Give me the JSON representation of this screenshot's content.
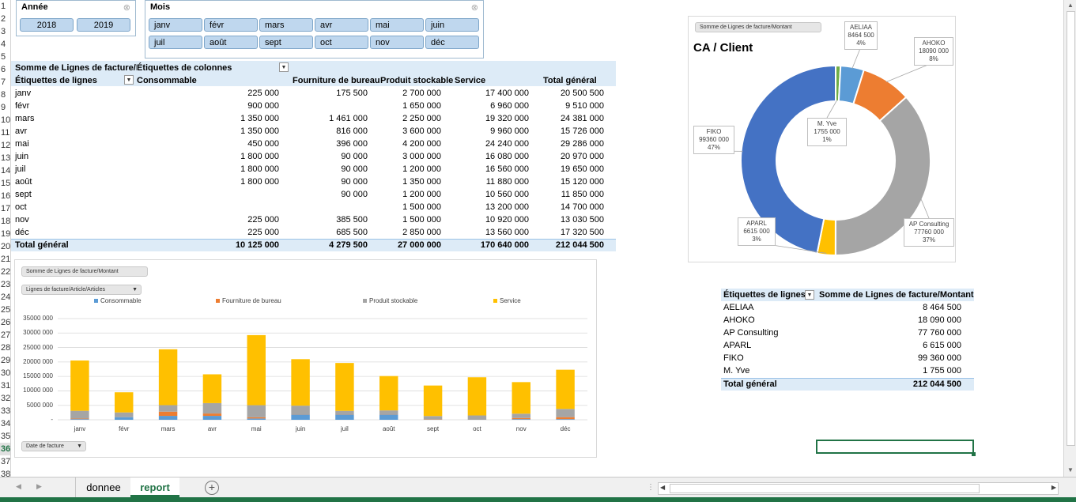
{
  "slicers": {
    "year": {
      "title": "Année",
      "items": [
        "2018",
        "2019"
      ]
    },
    "month": {
      "title": "Mois",
      "items": [
        "janv",
        "févr",
        "mars",
        "avr",
        "mai",
        "juin",
        "juil",
        "août",
        "sept",
        "oct",
        "nov",
        "déc"
      ]
    }
  },
  "pivot": {
    "header_value": "Somme de Lignes de facture/Montant",
    "header_columns": "Étiquettes de colonnes",
    "row_label": "Étiquettes de lignes",
    "columns": [
      "Consommable",
      "Fourniture de bureau",
      "Produit stockable",
      "Service",
      "Total général"
    ],
    "rows": [
      {
        "label": "janv",
        "values": [
          "225 000",
          "175 500",
          "2 700 000",
          "17 400 000",
          "20 500 500"
        ]
      },
      {
        "label": "févr",
        "values": [
          "900 000",
          "",
          "1 650 000",
          "6 960 000",
          "9 510 000"
        ]
      },
      {
        "label": "mars",
        "values": [
          "1 350 000",
          "1 461 000",
          "2 250 000",
          "19 320 000",
          "24 381 000"
        ]
      },
      {
        "label": "avr",
        "values": [
          "1 350 000",
          "816 000",
          "3 600 000",
          "9 960 000",
          "15 726 000"
        ]
      },
      {
        "label": "mai",
        "values": [
          "450 000",
          "396 000",
          "4 200 000",
          "24 240 000",
          "29 286 000"
        ]
      },
      {
        "label": "juin",
        "values": [
          "1 800 000",
          "90 000",
          "3 000 000",
          "16 080 000",
          "20 970 000"
        ]
      },
      {
        "label": "juil",
        "values": [
          "1 800 000",
          "90 000",
          "1 200 000",
          "16 560 000",
          "19 650 000"
        ]
      },
      {
        "label": "août",
        "values": [
          "1 800 000",
          "90 000",
          "1 350 000",
          "11 880 000",
          "15 120 000"
        ]
      },
      {
        "label": "sept",
        "values": [
          "",
          "90 000",
          "1 200 000",
          "10 560 000",
          "11 850 000"
        ]
      },
      {
        "label": "oct",
        "values": [
          "",
          "",
          "1 500 000",
          "13 200 000",
          "14 700 000"
        ]
      },
      {
        "label": "nov",
        "values": [
          "225 000",
          "385 500",
          "1 500 000",
          "10 920 000",
          "13 030 500"
        ]
      },
      {
        "label": "déc",
        "values": [
          "225 000",
          "685 500",
          "2 850 000",
          "13 560 000",
          "17 320 500"
        ]
      }
    ],
    "total_label": "Total général",
    "total_values": [
      "10 125 000",
      "4 279 500",
      "27 000 000",
      "170 640 000",
      "212 044 500"
    ]
  },
  "client_table": {
    "row_label": "Étiquettes de lignes",
    "value_label": "Somme de Lignes de facture/Montant",
    "rows": [
      {
        "label": "AELIAA",
        "value": "8 464 500"
      },
      {
        "label": "AHOKO",
        "value": "18 090 000"
      },
      {
        "label": "AP Consulting",
        "value": "77 760 000"
      },
      {
        "label": "APARL",
        "value": "6 615 000"
      },
      {
        "label": "FIKO",
        "value": "99 360 000"
      },
      {
        "label": "M. Yve",
        "value": "1 755 000"
      }
    ],
    "total_label": "Total général",
    "total_value": "212 044 500"
  },
  "donut_chart": {
    "field_button": "Somme de Lignes de facture/Montant",
    "title": "CA / Client",
    "chart_data": {
      "type": "pie",
      "title": "CA / Client",
      "labels": [
        "M. Yve",
        "AELIAA",
        "AHOKO",
        "AP Consulting",
        "APARL",
        "FIKO"
      ],
      "values": [
        1755000,
        8464500,
        18090000,
        77760000,
        6615000,
        99360000
      ],
      "colors": [
        "#70ad47",
        "#5b9bd5",
        "#ed7d31",
        "#a5a5a5",
        "#ffc000",
        "#4472c4"
      ],
      "callouts": [
        {
          "name": "AELIAA",
          "value": "8464 500",
          "pct": "4%"
        },
        {
          "name": "AHOKO",
          "value": "18090 000",
          "pct": "8%"
        },
        {
          "name": "M. Yve",
          "value": "1755 000",
          "pct": "1%"
        },
        {
          "name": "FIKO",
          "value": "99360 000",
          "pct": "47%"
        },
        {
          "name": "APARL",
          "value": "6615 000",
          "pct": "3%"
        },
        {
          "name": "AP Consulting",
          "value": "77760 000",
          "pct": "37%"
        }
      ]
    }
  },
  "bar_chart": {
    "field_button_value": "Somme de Lignes de facture/Montant",
    "field_button_axis": "Lignes de facture/Article/Articles",
    "field_button_date": "Date de facture",
    "chart_data": {
      "type": "bar",
      "stacked": true,
      "categories": [
        "janv",
        "févr",
        "mars",
        "avr",
        "mai",
        "juin",
        "juil",
        "août",
        "sept",
        "oct",
        "nov",
        "déc"
      ],
      "series": [
        {
          "name": "Consommable",
          "color": "#5b9bd5",
          "values": [
            225000,
            900000,
            1350000,
            1350000,
            450000,
            1800000,
            1800000,
            1800000,
            0,
            0,
            225000,
            225000
          ]
        },
        {
          "name": "Fourniture de bureau",
          "color": "#ed7d31",
          "values": [
            175500,
            0,
            1461000,
            816000,
            396000,
            90000,
            90000,
            90000,
            90000,
            0,
            385500,
            685500
          ]
        },
        {
          "name": "Produit stockable",
          "color": "#a5a5a5",
          "values": [
            2700000,
            1650000,
            2250000,
            3600000,
            4200000,
            3000000,
            1200000,
            1350000,
            1200000,
            1500000,
            1500000,
            2850000
          ]
        },
        {
          "name": "Service",
          "color": "#ffc000",
          "values": [
            17400000,
            6960000,
            19320000,
            9960000,
            24240000,
            16080000,
            16560000,
            11880000,
            10560000,
            13200000,
            10920000,
            13560000
          ]
        }
      ],
      "ylim": [
        0,
        35000000
      ],
      "yticks": [
        "35000 000",
        "30000 000",
        "25000 000",
        "20000 000",
        "15000 000",
        "10000 000",
        "5000 000",
        "-"
      ],
      "legend_position": "top",
      "grid": true
    }
  },
  "sheet_tabs": [
    "donnee",
    "report"
  ],
  "active_tab": "report",
  "add_sheet_symbol": "+"
}
